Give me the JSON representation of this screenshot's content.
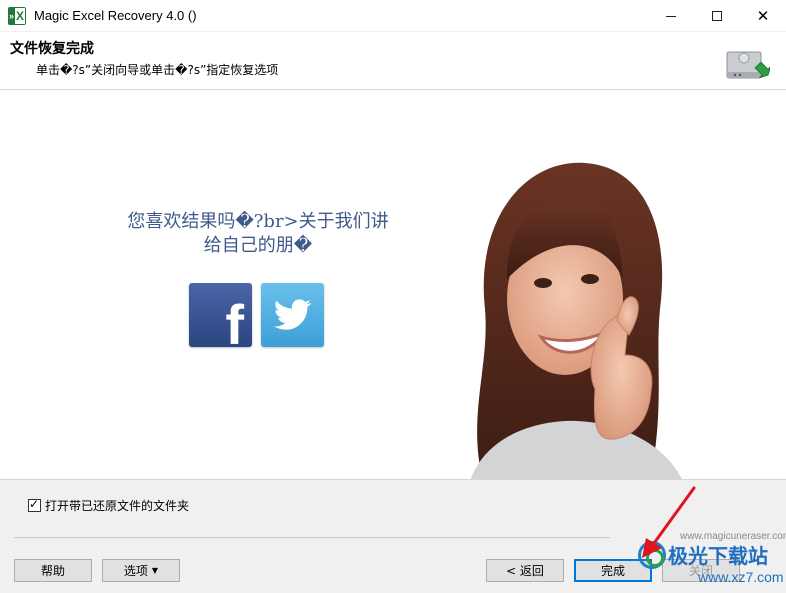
{
  "window": {
    "title": "Magic Excel Recovery 4.0 ()",
    "minimize_symbol": "",
    "maximize_symbol": "",
    "close_symbol": "✕"
  },
  "header": {
    "title": "文件恢复完成",
    "subtitle": "单击�?s”关闭向导或单击�?s”指定恢复选项",
    "icon": "drive-restore-icon"
  },
  "main": {
    "share_line1": "您喜欢结果吗�?br>关于我们讲",
    "share_line2": "给自己的朋�",
    "facebook_glyph": "f",
    "facebook_icon": "facebook-icon",
    "twitter_icon": "twitter-icon",
    "photo": "smiling-woman-thumbs-up-photo"
  },
  "bottom": {
    "checkbox_checked": true,
    "checkbox_label": "打开带已还原文件的文件夹",
    "brand_text": "www.magicuneraser.com",
    "buttons": {
      "help": "帮助",
      "options": "选项",
      "back": "< 返回",
      "finish": "完成",
      "close": "关闭"
    }
  },
  "watermark": {
    "title": "极光下载站",
    "subtitle": "www.xz7.com"
  },
  "colors": {
    "share_text": "#3f5a8a",
    "facebook": "#3b5998",
    "twitter": "#55acee",
    "accent": "#0078d7",
    "annotation_arrow": "#e0141e"
  }
}
